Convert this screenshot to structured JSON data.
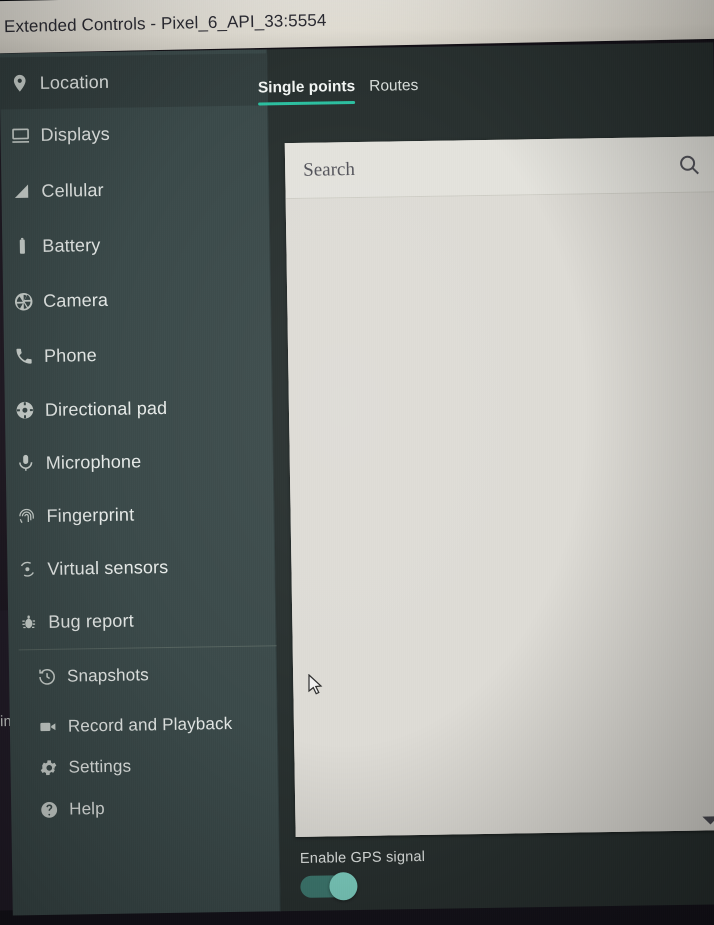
{
  "window": {
    "title": "Extended Controls - Pixel_6_API_33:5554"
  },
  "background": {
    "left_window_label": "im"
  },
  "sidebar": {
    "items": [
      {
        "label": "Location",
        "icon": "location-pin-icon",
        "selected": true
      },
      {
        "label": "Displays",
        "icon": "monitor-icon",
        "selected": false
      },
      {
        "label": "Cellular",
        "icon": "signal-bars-icon",
        "selected": false
      },
      {
        "label": "Battery",
        "icon": "battery-icon",
        "selected": false
      },
      {
        "label": "Camera",
        "icon": "aperture-icon",
        "selected": false
      },
      {
        "label": "Phone",
        "icon": "phone-handset-icon",
        "selected": false
      },
      {
        "label": "Directional pad",
        "icon": "dpad-icon",
        "selected": false
      },
      {
        "label": "Microphone",
        "icon": "microphone-icon",
        "selected": false
      },
      {
        "label": "Fingerprint",
        "icon": "fingerprint-icon",
        "selected": false
      },
      {
        "label": "Virtual sensors",
        "icon": "sensors-icon",
        "selected": false
      },
      {
        "label": "Bug report",
        "icon": "bug-icon",
        "selected": false
      }
    ],
    "footer_items": [
      {
        "label": "Snapshots",
        "icon": "history-clock-icon"
      },
      {
        "label": "Record and Playback",
        "icon": "video-camera-icon"
      },
      {
        "label": "Settings",
        "icon": "gear-icon"
      },
      {
        "label": "Help",
        "icon": "question-circle-icon"
      }
    ]
  },
  "main": {
    "tabs": [
      {
        "label": "Single points",
        "active": true
      },
      {
        "label": "Routes",
        "active": false
      }
    ],
    "search": {
      "placeholder": "Search",
      "value": "",
      "icon": "search-icon"
    },
    "scrollbar": {
      "down_arrow_icon": "chevron-down-icon"
    },
    "gps": {
      "label": "Enable GPS signal",
      "enabled": true
    }
  },
  "colors": {
    "titlebar": "#e7e3d9",
    "sidebar": "#3b4a4a",
    "sidebar_selected": "#333f3f",
    "panel": "#28302f",
    "card": "#dddcd6",
    "accent_teal": "#2bbfa0",
    "toggle_knob": "#7fd3c4"
  }
}
